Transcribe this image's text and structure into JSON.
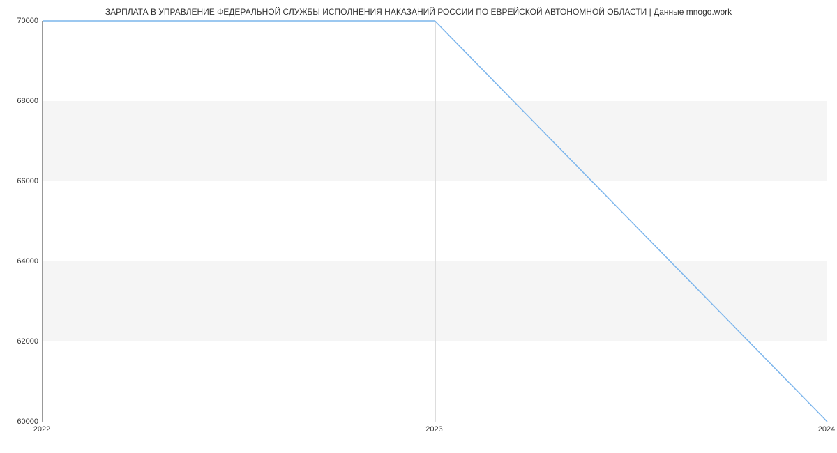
{
  "chart_data": {
    "type": "line",
    "title": "ЗАРПЛАТА В УПРАВЛЕНИЕ ФЕДЕРАЛЬНОЙ СЛУЖБЫ ИСПОЛНЕНИЯ НАКАЗАНИЙ РОССИИ ПО ЕВРЕЙСКОЙ АВТОНОМНОЙ ОБЛАСТИ | Данные mnogo.work",
    "x": [
      2022,
      2023,
      2024
    ],
    "values": [
      70000,
      70000,
      60000
    ],
    "x_ticks": [
      "2022",
      "2023",
      "2024"
    ],
    "y_ticks": [
      "60000",
      "62000",
      "64000",
      "66000",
      "68000",
      "70000"
    ],
    "xlim": [
      2022,
      2024
    ],
    "ylim": [
      60000,
      70000
    ],
    "xlabel": "",
    "ylabel": "",
    "line_color": "#7cb5ec"
  }
}
